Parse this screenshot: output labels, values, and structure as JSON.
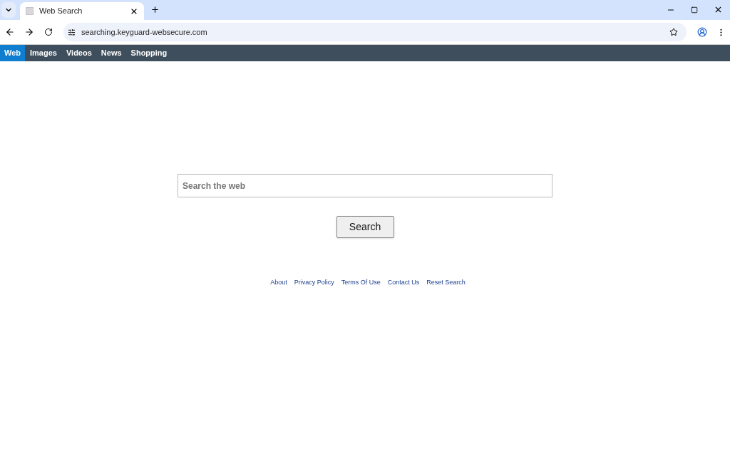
{
  "browser": {
    "tab": {
      "title": "Web Search"
    },
    "url": "searching.keyguard-websecure.com"
  },
  "nav": [
    {
      "label": "Web",
      "selected": true
    },
    {
      "label": "Images",
      "selected": false
    },
    {
      "label": "Videos",
      "selected": false
    },
    {
      "label": "News",
      "selected": false
    },
    {
      "label": "Shopping",
      "selected": false
    }
  ],
  "search": {
    "placeholder": "Search the web",
    "button": "Search"
  },
  "footer_links": [
    "About",
    "Privacy Policy",
    "Terms Of Use",
    "Contact Us",
    "Reset Search"
  ]
}
